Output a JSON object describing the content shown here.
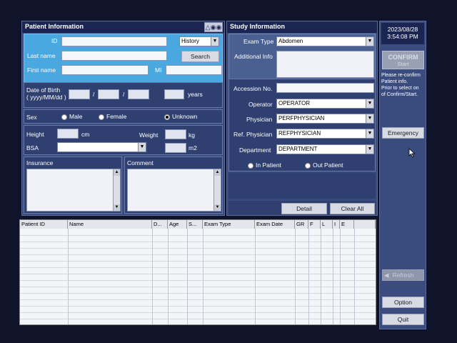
{
  "patient": {
    "title": "Patient Information",
    "id_label": "ID",
    "id_value": "",
    "history_select": "History",
    "lastname_label": "Last name",
    "search_button": "Search",
    "firstname_label": "First name",
    "mi_label": "MI",
    "dob_label_1": "Date of Birth",
    "dob_label_2": "( yyyy/MM/dd )",
    "dob_sep": "/",
    "years_label": "years",
    "sex_label": "Sex",
    "sex_options": [
      "Male",
      "Female",
      "Unknown"
    ],
    "sex_selected": "Unknown",
    "height_label": "Height",
    "height_unit": "cm",
    "weight_label": "Weight",
    "weight_unit": "kg",
    "bsa_label": "BSA",
    "bsa_unit": "m2",
    "insurance_label": "Insurance",
    "comment_label": "Comment"
  },
  "study": {
    "title": "Study Information",
    "exam_type_label": "Exam Type",
    "exam_type_value": "Abdomen",
    "additional_info_label": "Additional Info",
    "accession_label": "Accession No.",
    "operator_label": "Operator",
    "operator_value": "OPERATOR",
    "physician_label": "Physician",
    "physician_value": "PERFPHYSICIAN",
    "ref_physician_label": "Ref. Physician",
    "ref_physician_value": "REFPHYSICIAN",
    "department_label": "Department",
    "department_value": "DEPARTMENT",
    "patient_type_options": [
      "In Patient",
      "Out Patient"
    ],
    "detail_button": "Detail",
    "clear_all_button": "Clear All"
  },
  "sidebar": {
    "date": "2023/08/28",
    "time": "3:54:08 PM",
    "confirm_button": "CONFIRM",
    "confirm_sub": "Start",
    "message": [
      "Please re-confirm",
      "Patient info.",
      "Prior to select on",
      "of Confirm/Start."
    ],
    "emergency_button": "Emergency",
    "refresh_button": "Refresh",
    "option_button": "Option",
    "quit_button": "Quit"
  },
  "table": {
    "headers": [
      "Patient ID",
      "Name",
      "D...",
      "Age",
      "S...",
      "Exam Type",
      "Exam Date",
      "GR",
      "F",
      "L",
      "I",
      "E"
    ]
  },
  "colors": {
    "background": "#10142a",
    "panel": "#3a4c7e",
    "title_bar": "#1a2552",
    "accent_blue": "#4aa8e0"
  }
}
